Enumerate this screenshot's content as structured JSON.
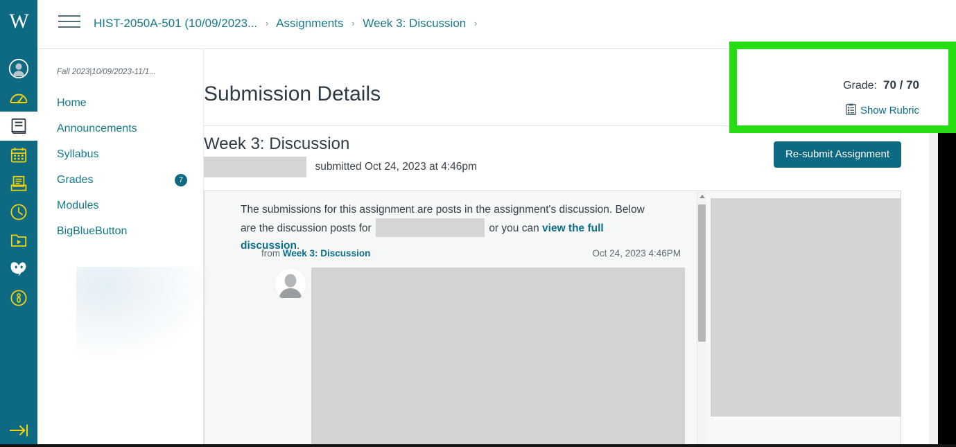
{
  "global_nav": {
    "logo_text": "W",
    "items": [
      {
        "name": "account",
        "icon": "user-circle-icon"
      },
      {
        "name": "dashboard",
        "icon": "dashboard-gauge-icon"
      },
      {
        "name": "courses",
        "icon": "book-icon",
        "active": true
      },
      {
        "name": "calendar",
        "icon": "calendar-icon"
      },
      {
        "name": "inbox",
        "icon": "inbox-tray-icon"
      },
      {
        "name": "history",
        "icon": "clock-icon"
      },
      {
        "name": "studio",
        "icon": "video-folder-icon"
      },
      {
        "name": "help-chat",
        "icon": "chat-heart-icon"
      },
      {
        "name": "help",
        "icon": "info-badge-icon"
      }
    ],
    "collapse": {
      "name": "expand-nav",
      "icon": "arrow-to-right-icon"
    }
  },
  "topbar": {
    "hamburger_label": "menu-icon",
    "breadcrumb": [
      {
        "label": "HIST-2050A-501 (10/09/2023..."
      },
      {
        "label": "Assignments"
      },
      {
        "label": "Week 3: Discussion"
      }
    ],
    "separator": "›"
  },
  "course_nav": {
    "term_label": "Fall 2023|10/09/2023-11/1...",
    "items": [
      {
        "label": "Home",
        "badge": ""
      },
      {
        "label": "Announcements",
        "badge": ""
      },
      {
        "label": "Syllabus",
        "badge": ""
      },
      {
        "label": "Grades",
        "badge": "7"
      },
      {
        "label": "Modules",
        "badge": ""
      },
      {
        "label": "BigBlueButton",
        "badge": ""
      }
    ]
  },
  "main": {
    "page_title": "Submission Details",
    "assignment_title": "Week 3: Discussion",
    "submitted_text": "submitted Oct 24, 2023 at 4:46pm",
    "resubmit_label": "Re-submit Assignment"
  },
  "preview": {
    "intro_part1": "The submissions for this assignment are posts in the assignment's discussion. Below are the discussion posts for",
    "intro_part2": "or you can",
    "full_discussion_link": "view the full discussion",
    "intro_end": ".",
    "from_label": "from",
    "from_link": "Week 3: Discussion",
    "post_date": "Oct 24, 2023 4:46PM",
    "avatar_name": "avatar-icon",
    "scrollbar_name": "preview-scrollbar"
  },
  "grade": {
    "label": "Grade:",
    "value": "70 / 70",
    "show_rubric_label": "Show Rubric",
    "rubric_icon": "rubric-clipboard-icon",
    "highlight_color": "#26dd12"
  },
  "colors": {
    "brand_teal": "#0d6a82",
    "link_teal": "#0a6f8a",
    "highlight_green": "#26dd12",
    "text_dark": "#2d3b45"
  }
}
